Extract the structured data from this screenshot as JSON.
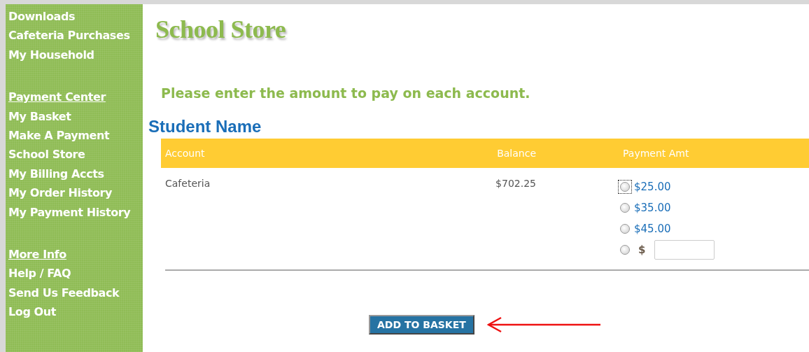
{
  "sidebar": {
    "items": [
      {
        "kind": "link",
        "label": "Downloads"
      },
      {
        "kind": "link",
        "label": "Cafeteria Purchases"
      },
      {
        "kind": "link",
        "label": "My Household"
      },
      {
        "kind": "heading",
        "label": "Payment Center"
      },
      {
        "kind": "link",
        "label": "My Basket"
      },
      {
        "kind": "link",
        "label": "Make A Payment"
      },
      {
        "kind": "link",
        "label": "School Store"
      },
      {
        "kind": "link",
        "label": "My Billing Accts"
      },
      {
        "kind": "link",
        "label": "My Order History"
      },
      {
        "kind": "link",
        "label": "My Payment History"
      },
      {
        "kind": "heading",
        "label": "More Info"
      },
      {
        "kind": "link",
        "label": "Help / FAQ"
      },
      {
        "kind": "link",
        "label": "Send Us Feedback"
      },
      {
        "kind": "link",
        "label": "Log Out"
      }
    ]
  },
  "page_title": "School Store",
  "instruction": "Please enter the amount to pay on each account.",
  "student_name": "Student Name",
  "table": {
    "columns": [
      "Account",
      "Balance",
      "Payment Amt"
    ],
    "rows": [
      {
        "account": "Cafeteria",
        "balance": "$702.25",
        "options": [
          {
            "kind": "amount",
            "label": "$25.00",
            "selected": false,
            "focused": true
          },
          {
            "kind": "amount",
            "label": "$35.00",
            "selected": false,
            "focused": false
          },
          {
            "kind": "amount",
            "label": "$45.00",
            "selected": false,
            "focused": false
          },
          {
            "kind": "custom",
            "label": "$",
            "selected": false,
            "focused": false
          }
        ]
      }
    ]
  },
  "add_button": "ADD TO BASKET"
}
